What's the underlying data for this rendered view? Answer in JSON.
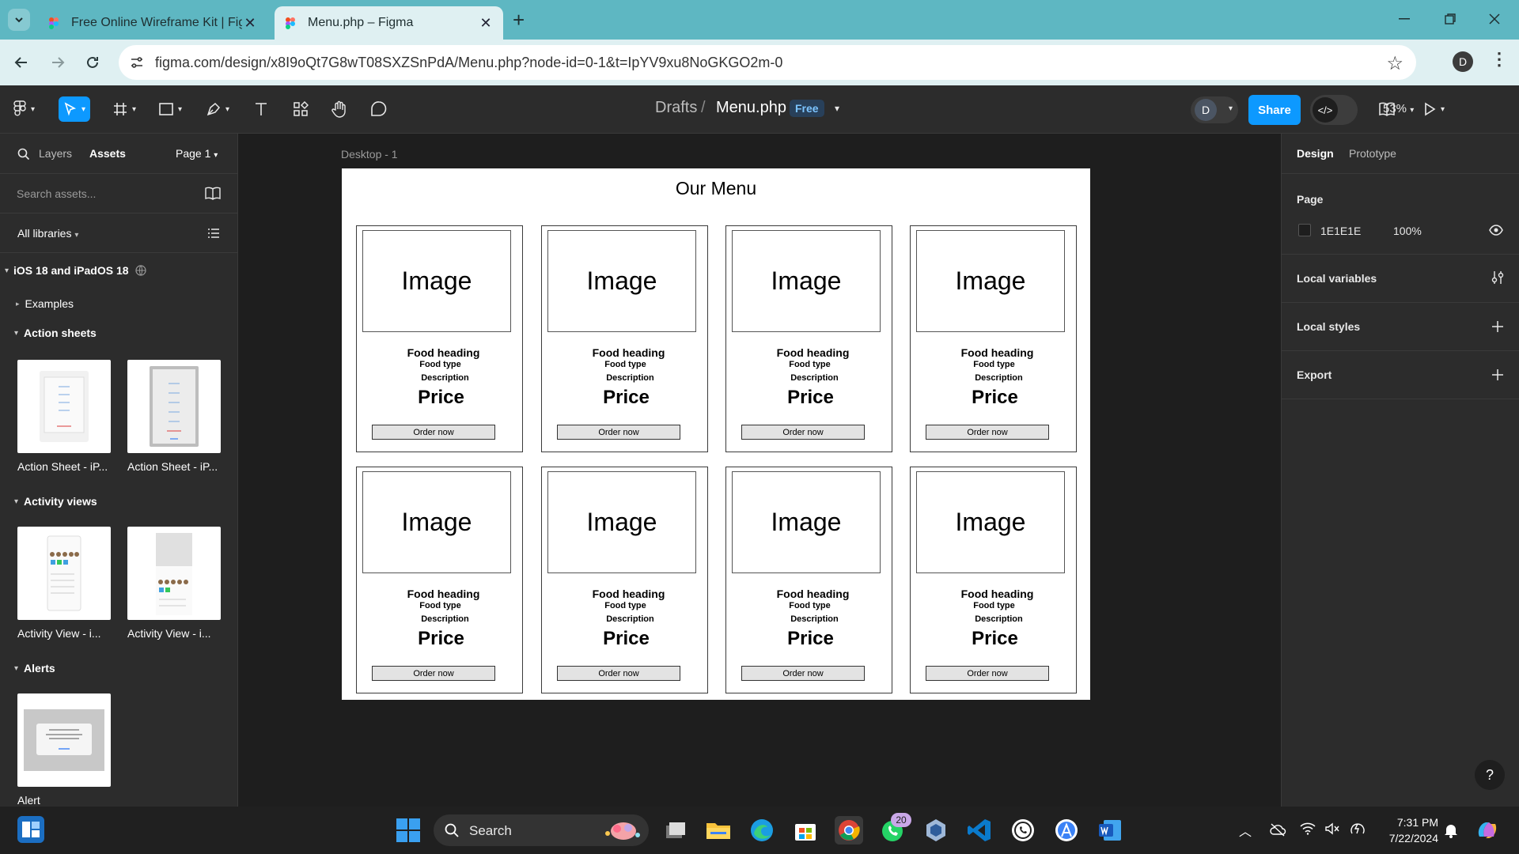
{
  "browser": {
    "tabs": [
      {
        "title": "Free Online Wireframe Kit | Figma",
        "active": false
      },
      {
        "title": "Menu.php – Figma",
        "active": true
      }
    ],
    "url": "figma.com/design/x8I9oQt7G8wT08SXZSnPdA/Menu.php?node-id=0-1&t=IpYV9xu8NoGKGO2m-0",
    "profile_initial": "D"
  },
  "toolbar": {
    "breadcrumb_root": "Drafts",
    "breadcrumb_sep": "/",
    "file_name": "Menu.php",
    "plan_badge": "Free",
    "avatar_initial": "D",
    "share_label": "Share",
    "zoom": "53%"
  },
  "left_panel": {
    "tab_layers": "Layers",
    "tab_assets": "Assets",
    "page_selector": "Page 1",
    "search_placeholder": "Search assets...",
    "libraries_label": "All libraries",
    "library_name": "iOS 18 and iPadOS 18",
    "sections": {
      "examples": "Examples",
      "action_sheets": "Action sheets",
      "activity_views": "Activity views",
      "alerts": "Alerts"
    },
    "assets": {
      "action_sheet_1": "Action Sheet - iP...",
      "action_sheet_2": "Action Sheet - iP...",
      "activity_view_1": "Activity View - i...",
      "activity_view_2": "Activity View - i...",
      "alert": "Alert"
    }
  },
  "canvas": {
    "frame_label": "Desktop - 1",
    "menu_title": "Our Menu",
    "cards": [
      {
        "image": "Image",
        "heading": "Food heading",
        "type": "Food type",
        "description": "Description",
        "price": "Price",
        "button": "Order now"
      },
      {
        "image": "Image",
        "heading": "Food heading",
        "type": "Food type",
        "description": "Description",
        "price": "Price",
        "button": "Order now"
      },
      {
        "image": "Image",
        "heading": "Food heading",
        "type": "Food type",
        "description": "Description",
        "price": "Price",
        "button": "Order now"
      },
      {
        "image": "Image",
        "heading": "Food heading",
        "type": "Food type",
        "description": "Description",
        "price": "Price",
        "button": "Order now"
      },
      {
        "image": "Image",
        "heading": "Food heading",
        "type": "Food type",
        "description": "Description",
        "price": "Price",
        "button": "Order now"
      },
      {
        "image": "Image",
        "heading": "Food heading",
        "type": "Food type",
        "description": "Description",
        "price": "Price",
        "button": "Order now"
      },
      {
        "image": "Image",
        "heading": "Food heading",
        "type": "Food type",
        "description": "Description",
        "price": "Price",
        "button": "Order now"
      },
      {
        "image": "Image",
        "heading": "Food heading",
        "type": "Food type",
        "description": "Description",
        "price": "Price",
        "button": "Order now"
      }
    ]
  },
  "right_panel": {
    "tab_design": "Design",
    "tab_prototype": "Prototype",
    "page_title": "Page",
    "page_color": "1E1E1E",
    "page_opacity": "100%",
    "local_variables": "Local variables",
    "local_styles": "Local styles",
    "export": "Export",
    "help": "?"
  },
  "taskbar": {
    "search_label": "Search",
    "whatsapp_badge": "20",
    "time": "7:31 PM",
    "date": "7/22/2024"
  },
  "colors": {
    "accent": "#0d99ff",
    "tabstrip": "#5eb7c2",
    "canvas": "#1e1e1e",
    "panel": "#2c2c2c"
  }
}
